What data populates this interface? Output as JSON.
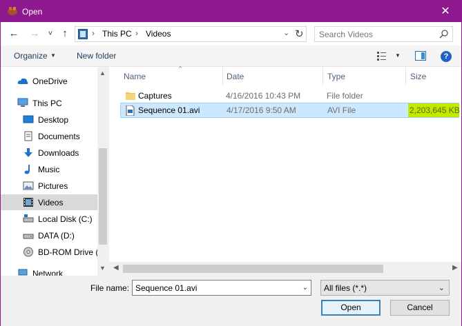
{
  "window": {
    "title": "Open",
    "close_glyph": "✕"
  },
  "nav": {
    "back_glyph": "←",
    "forward_glyph": "→",
    "recent_glyph": "˅",
    "up_glyph": "↑",
    "breadcrumb": [
      "This PC",
      "Videos"
    ],
    "crumb_sep": "›",
    "refresh_glyph": "↻",
    "dropdown_glyph": "⌄",
    "search_placeholder": "Search Videos"
  },
  "toolbar": {
    "organize_label": "Organize",
    "newfolder_label": "New folder",
    "caret": "▼",
    "help_glyph": "?"
  },
  "sidebar": {
    "items": [
      {
        "label": "OneDrive",
        "icon": "cloud-icon"
      },
      {
        "label": "This PC",
        "icon": "computer-icon"
      },
      {
        "label": "Desktop",
        "icon": "desktop-icon"
      },
      {
        "label": "Documents",
        "icon": "documents-icon"
      },
      {
        "label": "Downloads",
        "icon": "downloads-icon"
      },
      {
        "label": "Music",
        "icon": "music-icon"
      },
      {
        "label": "Pictures",
        "icon": "pictures-icon"
      },
      {
        "label": "Videos",
        "icon": "videos-icon"
      },
      {
        "label": "Local Disk (C:)",
        "icon": "local-disk-icon"
      },
      {
        "label": "DATA (D:)",
        "icon": "drive-icon"
      },
      {
        "label": "BD-ROM Drive (E",
        "icon": "bd-rom-icon"
      },
      {
        "label": "Network",
        "icon": "network-icon"
      }
    ],
    "selected": "Videos",
    "scroll_up": "▲",
    "scroll_down": "▼"
  },
  "filelist": {
    "columns": [
      "Name",
      "Date",
      "Type",
      "Size"
    ],
    "sort_glyph": "^",
    "rows": [
      {
        "name": "Captures",
        "date": "4/16/2016 10:43 PM",
        "type": "File folder",
        "size": ""
      },
      {
        "name": "Sequence 01.avi",
        "date": "4/17/2016 9:50 AM",
        "type": "AVI File",
        "size": "2,203,645 KB"
      }
    ],
    "selected_row": 1,
    "h_left": "◀",
    "h_right": "▶"
  },
  "bottom": {
    "filename_label": "File name:",
    "filename_value": "Sequence 01.avi",
    "filter_value": "All files (*.*)",
    "dd_glyph": "⌄",
    "open_label": "Open",
    "cancel_label": "Cancel"
  },
  "colors": {
    "title_bar": "#8e198e",
    "selection": "#cce8ff",
    "size_highlight": "#c2e800"
  }
}
